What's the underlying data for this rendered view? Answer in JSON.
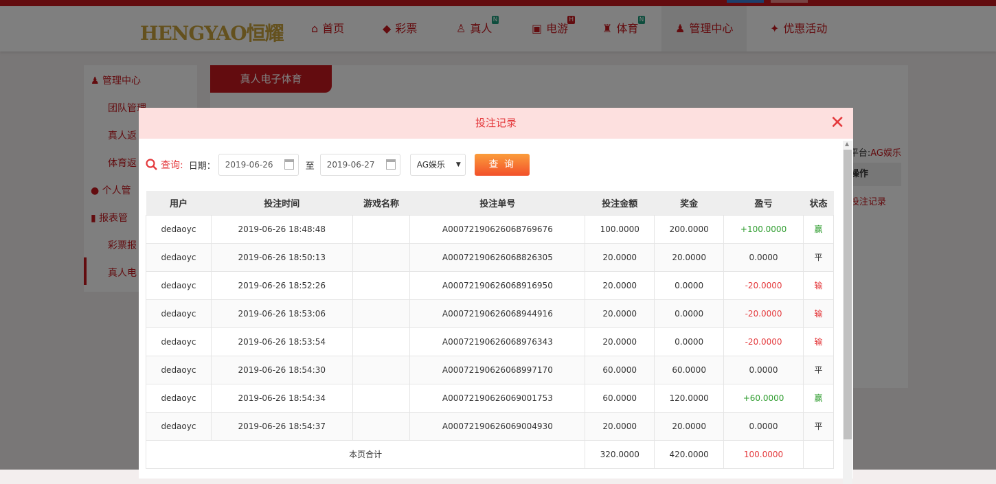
{
  "nav": {
    "logo": "HENGYAO恒耀",
    "items": [
      {
        "label": "首页",
        "icon": "⌂",
        "badge": null
      },
      {
        "label": "彩票",
        "icon": "◆",
        "badge": null
      },
      {
        "label": "真人",
        "icon": "♙",
        "badge": "N"
      },
      {
        "label": "电游",
        "icon": "▣",
        "badge": "H"
      },
      {
        "label": "体育",
        "icon": "♜",
        "badge": "N"
      },
      {
        "label": "管理中心",
        "icon": "♟",
        "badge": null
      },
      {
        "label": "优惠活动",
        "icon": "✦",
        "badge": null
      }
    ]
  },
  "sidebar": {
    "title": "管理中心",
    "items": [
      "团队管理",
      "真人返",
      "体育返",
      "个人管",
      "报表管",
      "彩票报",
      "真人电"
    ]
  },
  "main": {
    "tab": "真人电子体育",
    "platform_label": "平台:",
    "platform": "AG娱乐",
    "col_action": "操作",
    "link": "投注记录"
  },
  "modal": {
    "title": "投注记录",
    "query_label": "查询:",
    "date_label": "日期：",
    "date_from": "2019-06-26",
    "to": "至",
    "date_to": "2019-06-27",
    "platform": "AG娱乐",
    "search_button": "查 询",
    "columns": [
      "用户",
      "投注时间",
      "游戏名称",
      "投注单号",
      "投注金额",
      "奖金",
      "盈亏",
      "状态"
    ],
    "rows": [
      [
        "dedaoyc",
        "2019-06-26 18:48:48",
        "",
        "A00072190626068769676",
        "100.0000",
        "200.0000",
        "+100.0000",
        "赢"
      ],
      [
        "dedaoyc",
        "2019-06-26 18:50:13",
        "",
        "A00072190626068826305",
        "20.0000",
        "20.0000",
        "0.0000",
        "平"
      ],
      [
        "dedaoyc",
        "2019-06-26 18:52:26",
        "",
        "A00072190626068916950",
        "20.0000",
        "0.0000",
        "-20.0000",
        "输"
      ],
      [
        "dedaoyc",
        "2019-06-26 18:53:06",
        "",
        "A00072190626068944916",
        "20.0000",
        "0.0000",
        "-20.0000",
        "输"
      ],
      [
        "dedaoyc",
        "2019-06-26 18:53:54",
        "",
        "A00072190626068976343",
        "20.0000",
        "0.0000",
        "-20.0000",
        "输"
      ],
      [
        "dedaoyc",
        "2019-06-26 18:54:30",
        "",
        "A00072190626068997170",
        "60.0000",
        "60.0000",
        "0.0000",
        "平"
      ],
      [
        "dedaoyc",
        "2019-06-26 18:54:34",
        "",
        "A00072190626069001753",
        "60.0000",
        "120.0000",
        "+60.0000",
        "赢"
      ],
      [
        "dedaoyc",
        "2019-06-26 18:54:37",
        "",
        "A00072190626069004930",
        "20.0000",
        "20.0000",
        "0.0000",
        "平"
      ]
    ],
    "total": {
      "label": "本页合计",
      "amount": "320.0000",
      "prize": "420.0000",
      "profit": "100.0000"
    }
  },
  "colors": {
    "brand": "#c6191f",
    "win": "#2e9c2e",
    "lose": "#e4393c"
  }
}
